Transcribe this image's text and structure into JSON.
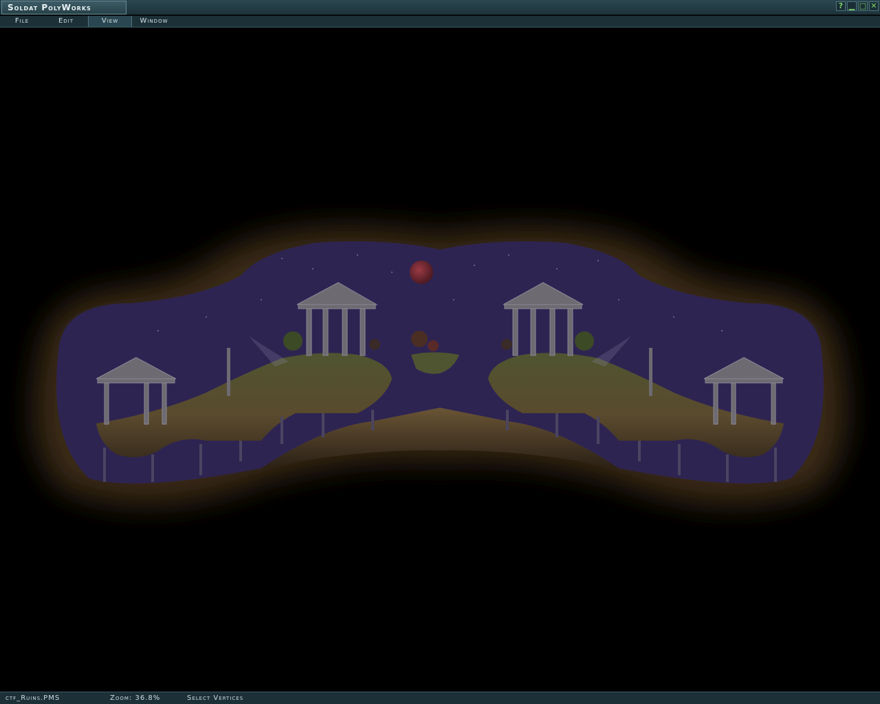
{
  "window": {
    "title": "Soldat PolyWorks",
    "controls": [
      {
        "name": "help-icon",
        "glyph": "?"
      },
      {
        "name": "minimize-icon",
        "glyph": "▁"
      },
      {
        "name": "maximize-icon",
        "glyph": "□"
      },
      {
        "name": "close-icon",
        "glyph": "✕"
      }
    ]
  },
  "menu": {
    "items": [
      {
        "label": "File"
      },
      {
        "label": "Edit"
      },
      {
        "label": "View",
        "active": true
      },
      {
        "label": "Window"
      }
    ]
  },
  "status": {
    "filename": "ctf_Ruins.PMS",
    "zoom": "Zoom: 36.8%",
    "mode": "Select Vertices"
  },
  "colors": {
    "sky": "#2e2452",
    "cave_glow": "#4a3520",
    "ground": "#5c4a2e",
    "grass": "#4f5530",
    "moon": "#7a2a33",
    "pillar": "#6e6a72"
  }
}
